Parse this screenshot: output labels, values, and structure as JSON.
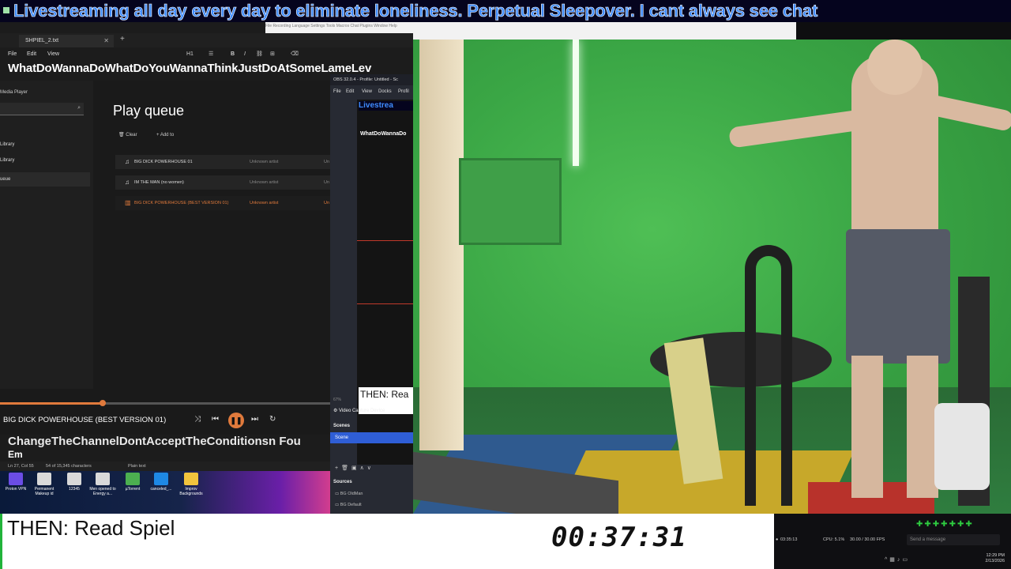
{
  "banner": {
    "text": "Livestreaming all day every day to eliminate loneliness. Perpetual Sleepover. I cant always see chat"
  },
  "notepad": {
    "tab_title": "SHPIEL_2.txt",
    "menus": [
      "File",
      "Edit",
      "View"
    ],
    "heading_label": "H1",
    "line1": "WhatDoWannaDoWhatDoYouWannaThinkJustDoAtSomeLameLev",
    "bottom_line": "ChangeTheChannelDontAcceptTheConditionsn Fou",
    "bottom_line2": "Em",
    "status_pos": "Ln 27, Col 55",
    "status_chars": "54 of 15,345 characters",
    "status_format": "Plain text"
  },
  "media_player": {
    "app_title": "Media Player",
    "side_items": [
      "Library",
      "Library",
      "ueue"
    ],
    "page_title": "Play queue",
    "clear_label": "Clear",
    "add_label": "Add to",
    "queue": [
      {
        "title": "BIG DICK POWERHOUSE 01",
        "artist": "Unknown artist",
        "active": false
      },
      {
        "title": "IM THE MAN (no women)",
        "artist": "Unknown artist",
        "active": false
      },
      {
        "title": "BIG DICK POWERHOUSE (BEST VERSION 01)",
        "artist": "Unknown artist",
        "active": true
      }
    ],
    "now_playing": "BIG DICK POWERHOUSE (BEST VERSION 01)",
    "progress": 0.31
  },
  "desktop": {
    "icons": [
      {
        "label": "Proton VPN",
        "color": "#6b4de6"
      },
      {
        "label": "Permanent Makeup id",
        "color": "#d9d9d9"
      },
      {
        "label": "12345",
        "color": "#d9d9d9"
      },
      {
        "label": "Men opened to Energy a...",
        "color": "#d9d9d9"
      },
      {
        "label": "µTorrent",
        "color": "#4caf50"
      },
      {
        "label": "canceled_...",
        "color": "#1e88e5"
      },
      {
        "label": "Improv Backgrounds",
        "color": "#f2c43d"
      }
    ]
  },
  "obs": {
    "title": "OBS 32.0.4 - Profile: Untitled - Sc",
    "menus": [
      "File",
      "Edit",
      "View",
      "Docks",
      "Profil"
    ],
    "preview_banner": "Livestrea",
    "preview_line": "WhatDoWannaDo",
    "preview_then": "THEN: Rea",
    "source_label": "Video Capture Device",
    "scenes_label": "Scenes",
    "scene_selected": "Scene",
    "sources_label": "Sources",
    "sources": [
      "BG OldMan",
      "BG Default"
    ],
    "zoom_text": "67%"
  },
  "topstrip": {
    "menu_text": "File   Recording   Language   Settings   Tools   Macros   Chat   Plugins   Window   Help"
  },
  "lower": {
    "then_text": "THEN: Read Spiel",
    "timer": "00:37:31"
  },
  "status": {
    "rec_time": "03:35:13",
    "cpu": "CPU: 5.1%",
    "fps": "30.00 / 30.00 FPS",
    "chat_placeholder": "Send a message",
    "clock_time": "12:29 PM",
    "clock_date": "2/13/2026",
    "green": "#2ecc40",
    "accent": "#e07a3c"
  }
}
